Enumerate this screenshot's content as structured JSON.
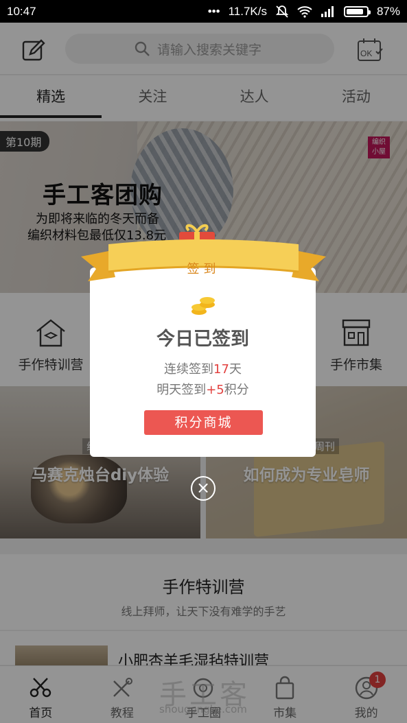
{
  "status_bar": {
    "time": "10:47",
    "network_speed": "11.7K/s",
    "battery": "87%",
    "battery_level": 0.87,
    "icons": [
      "more-dots-icon",
      "mute-bell-icon",
      "wifi-icon",
      "signal-icon",
      "battery-icon"
    ]
  },
  "header": {
    "edit_icon": "edit-icon",
    "search_placeholder": "请输入搜索关键字",
    "checkin_icon": "calendar-ok-icon",
    "checkin_icon_text": "OK"
  },
  "tabs": [
    {
      "label": "精选",
      "active": true
    },
    {
      "label": "关注",
      "active": false
    },
    {
      "label": "达人",
      "active": false
    },
    {
      "label": "活动",
      "active": false
    }
  ],
  "banner": {
    "issue": "第10期",
    "title": "手工客团购",
    "subtitle1": "为即将来临的冬天而备",
    "subtitle2": "编织材料包最低仅13.8元"
  },
  "nav_grid": [
    {
      "label": "手作特训营",
      "icon": "school-house-icon"
    },
    {
      "label": "手作市集",
      "icon": "market-store-icon"
    }
  ],
  "cards": [
    {
      "tag": "线",
      "title": "马赛克烛台diy体验"
    },
    {
      "tag": "周刊",
      "title": "如何成为专业皂师"
    }
  ],
  "section": {
    "title": "手作特训营",
    "subtitle": "线上拜师，让天下没有难学的手艺"
  },
  "course": {
    "name": "小肥杏羊毛湿毡特训营"
  },
  "bottom_nav": [
    {
      "label": "首页",
      "icon": "scissors-icon",
      "active": true
    },
    {
      "label": "教程",
      "icon": "tools-icon",
      "active": false
    },
    {
      "label": "手工圈",
      "icon": "circle-icon",
      "active": false
    },
    {
      "label": "市集",
      "icon": "shopping-bag-icon",
      "active": false
    },
    {
      "label": "我的",
      "icon": "user-icon",
      "active": false
    }
  ],
  "notification_count": "1",
  "watermark": {
    "text": "手工客",
    "url_text": "shougongke.com"
  },
  "dialog": {
    "ribbon_label": "签到",
    "title": "今日已签到",
    "streak_prefix": "连续签到",
    "streak_days": "17",
    "streak_suffix": "天",
    "tomorrow_prefix": "明天签到",
    "tomorrow_points": "+5",
    "tomorrow_suffix": "积分",
    "button_label": "积分商城",
    "close_icon": "close-circle-icon"
  },
  "colors": {
    "accent_red": "#e2413f",
    "button_red": "#ec5752",
    "ribbon_gold": "#f3c24a"
  }
}
